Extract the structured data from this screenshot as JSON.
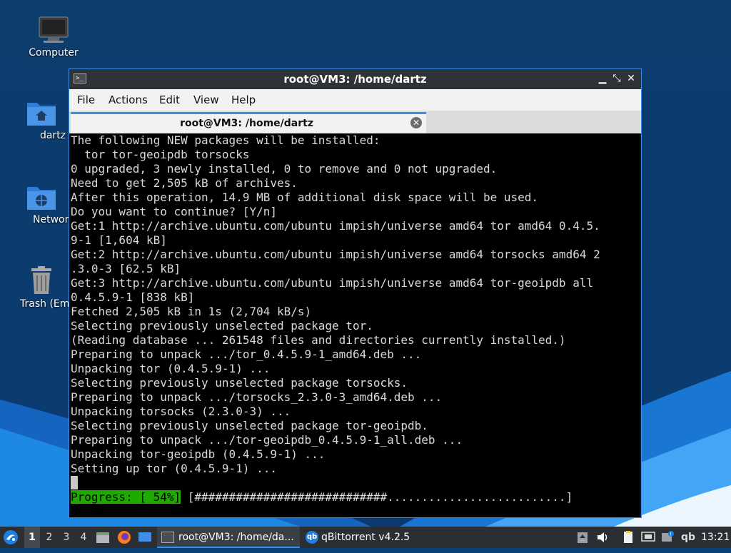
{
  "desktop": {
    "icons": [
      {
        "label": "Computer",
        "icon": "computer-icon"
      },
      {
        "label": "dartz",
        "icon": "home-folder-icon"
      },
      {
        "label": "Network",
        "icon": "network-folder-icon"
      },
      {
        "label": "Trash (Empty)",
        "icon": "trash-icon"
      }
    ]
  },
  "window": {
    "title": "root@VM3: /home/dartz",
    "menu": [
      "File",
      "Actions",
      "Edit",
      "View",
      "Help"
    ],
    "tab_title": "root@VM3: /home/dartz",
    "controls": {
      "minimize": "▁",
      "maximize": "⤡",
      "close": "✕"
    }
  },
  "terminal": {
    "lines": [
      "The following NEW packages will be installed:",
      "  tor tor-geoipdb torsocks",
      "0 upgraded, 3 newly installed, 0 to remove and 0 not upgraded.",
      "Need to get 2,505 kB of archives.",
      "After this operation, 14.9 MB of additional disk space will be used.",
      "Do you want to continue? [Y/n]",
      "Get:1 http://archive.ubuntu.com/ubuntu impish/universe amd64 tor amd64 0.4.5.",
      "9-1 [1,604 kB]",
      "Get:2 http://archive.ubuntu.com/ubuntu impish/universe amd64 torsocks amd64 2",
      ".3.0-3 [62.5 kB]",
      "Get:3 http://archive.ubuntu.com/ubuntu impish/universe amd64 tor-geoipdb all",
      "0.4.5.9-1 [838 kB]",
      "Fetched 2,505 kB in 1s (2,704 kB/s)",
      "Selecting previously unselected package tor.",
      "(Reading database ... 261548 files and directories currently installed.)",
      "Preparing to unpack .../tor_0.4.5.9-1_amd64.deb ...",
      "Unpacking tor (0.4.5.9-1) ...",
      "Selecting previously unselected package torsocks.",
      "Preparing to unpack .../torsocks_2.3.0-3_amd64.deb ...",
      "Unpacking torsocks (2.3.0-3) ...",
      "Selecting previously unselected package tor-geoipdb.",
      "Preparing to unpack .../tor-geoipdb_0.4.5.9-1_all.deb ...",
      "Unpacking tor-geoipdb (0.4.5.9-1) ...",
      "Setting up tor (0.4.5.9-1) ..."
    ],
    "progress_label": "Progress: [ 54%]",
    "progress_bar": " [############################..........................]"
  },
  "taskbar": {
    "workspaces": [
      "1",
      "2",
      "3",
      "4"
    ],
    "active_workspace": "1",
    "tasks": [
      {
        "label": "root@VM3: /home/da...",
        "icon": "terminal-icon"
      },
      {
        "label": "qBittorrent v4.2.5",
        "icon": "qbittorrent-icon"
      }
    ],
    "tray_qb": "qb",
    "clock": "13:21"
  },
  "colors": {
    "accent": "#3d8ee6",
    "progress": "#1faa00",
    "terminal_bg": "#000000",
    "terminal_fg": "#d9d9d9"
  }
}
